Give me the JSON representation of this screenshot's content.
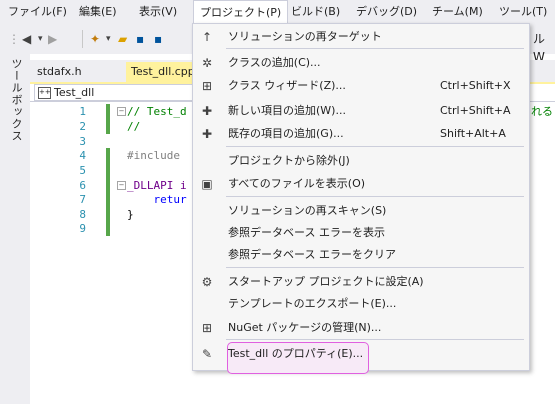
{
  "menubar": {
    "items": [
      "ファイル(F)",
      "編集(E)",
      "表示(V)",
      "プロジェクト(P)",
      "ビルド(B)",
      "デバッグ(D)",
      "チーム(M)",
      "ツール(T)"
    ]
  },
  "toolbox": {
    "label": "ツールボックス"
  },
  "tabs": [
    "stdafx.h",
    "Test_dll.cpp"
  ],
  "nav": {
    "scope": "Test_dll"
  },
  "editor": {
    "line_numbers": [
      "1",
      "2",
      "3",
      "4",
      "5",
      "6",
      "7",
      "8",
      "9"
    ],
    "lines": [
      "// Test_d",
      "//",
      "",
      "#include",
      "",
      "_DLLAPI i",
      "    retur",
      "}",
      ""
    ],
    "right_overflow": "れる"
  },
  "menu": {
    "items": [
      {
        "icon": "↑",
        "icon_name": "retarget-icon",
        "label": "ソリューションの再ターゲット",
        "shortcut": ""
      },
      {
        "icon": "✲",
        "icon_name": "add-class-icon",
        "label": "クラスの追加(C)...",
        "shortcut": ""
      },
      {
        "icon": "⊞",
        "icon_name": "class-wizard-icon",
        "label": "クラス ウィザード(Z)...",
        "shortcut": "Ctrl+Shift+X"
      },
      {
        "icon": "✚",
        "icon_name": "add-new-item-icon",
        "label": "新しい項目の追加(W)...",
        "shortcut": "Ctrl+Shift+A"
      },
      {
        "icon": "✚",
        "icon_name": "add-existing-item-icon",
        "label": "既存の項目の追加(G)...",
        "shortcut": "Shift+Alt+A"
      },
      {
        "icon": "",
        "icon_name": "",
        "label": "プロジェクトから除外(J)",
        "shortcut": ""
      },
      {
        "icon": "▣",
        "icon_name": "show-all-files-icon",
        "label": "すべてのファイルを表示(O)",
        "shortcut": ""
      },
      {
        "icon": "",
        "icon_name": "",
        "label": "ソリューションの再スキャン(S)",
        "shortcut": ""
      },
      {
        "icon": "",
        "icon_name": "",
        "label": "参照データベース エラーを表示",
        "shortcut": ""
      },
      {
        "icon": "",
        "icon_name": "",
        "label": "参照データベース エラーをクリア",
        "shortcut": ""
      },
      {
        "icon": "⚙",
        "icon_name": "gear-icon",
        "label": "スタートアップ プロジェクトに設定(A)",
        "shortcut": ""
      },
      {
        "icon": "",
        "icon_name": "",
        "label": "テンプレートのエクスポート(E)...",
        "shortcut": ""
      },
      {
        "icon": "⊞",
        "icon_name": "nuget-icon",
        "label": "NuGet パッケージの管理(N)...",
        "shortcut": ""
      },
      {
        "icon": "✎",
        "icon_name": "wrench-icon",
        "label": "Test_dll のプロパティ(E)...",
        "shortcut": ""
      }
    ]
  },
  "colors": {
    "accent_tab": "#fff29d",
    "highlight_border": "#e060e0",
    "margin_green": "#57a64a"
  }
}
